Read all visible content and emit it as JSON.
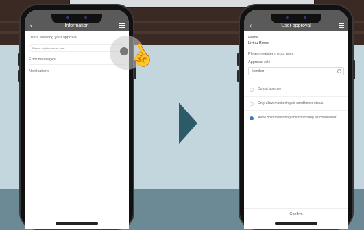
{
  "left_screen": {
    "title": "Information",
    "users_awaiting_label": "Users awaiting your approval",
    "pending_request_text": "Please register me as user",
    "error_messages_label": "Error messages",
    "notifications_label": "Notifications"
  },
  "right_screen": {
    "title": "User approval",
    "home_label": "Home",
    "home_value": "Living Room",
    "request_text": "Please register me as user.",
    "approval_role_label": "Approval role",
    "approval_role_value": "Member",
    "options": [
      {
        "label": "Do not approve",
        "checked": false
      },
      {
        "label": "Only allow monitoring air conditioner status",
        "checked": false
      },
      {
        "label": "Allow both monitoring and controlling air conditioner",
        "checked": true
      }
    ],
    "confirm_label": "Confirm"
  },
  "colors": {
    "header_bg": "#5a5a5a",
    "accent": "#3c78c8",
    "arrow": "#2d5a68"
  },
  "icons": {
    "back": "chevron-left-icon",
    "menu": "hamburger-menu-icon",
    "pointer": "tap-hand-icon",
    "select": "dropdown-icon"
  }
}
